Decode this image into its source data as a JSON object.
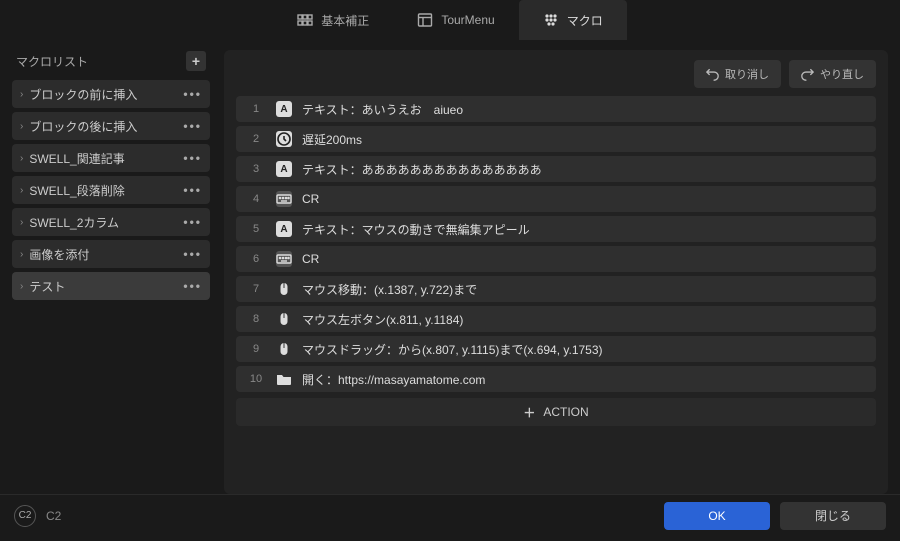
{
  "tabs": [
    {
      "label": "基本補正"
    },
    {
      "label": "TourMenu"
    },
    {
      "label": "マクロ"
    }
  ],
  "active_tab": 2,
  "sidebar": {
    "title": "マクロリスト",
    "items": [
      {
        "label": "ブロックの前に挿入"
      },
      {
        "label": "ブロックの後に挿入"
      },
      {
        "label": "SWELL_関連記事"
      },
      {
        "label": "SWELL_段落削除"
      },
      {
        "label": "SWELL_2カラム"
      },
      {
        "label": "画像を添付"
      },
      {
        "label": "テスト"
      }
    ],
    "active_index": 6
  },
  "toolbar": {
    "undo": "取り消し",
    "redo": "やり直し"
  },
  "actions": [
    {
      "n": 1,
      "icon": "A",
      "text": "テキスト：あいうえお　aiueo"
    },
    {
      "n": 2,
      "icon": "clock",
      "text": "遅延200ms"
    },
    {
      "n": 3,
      "icon": "A",
      "text": "テキスト：あああああああああああああああ"
    },
    {
      "n": 4,
      "icon": "kb",
      "text": "CR"
    },
    {
      "n": 5,
      "icon": "A",
      "text": "テキスト：マウスの動きで無編集アピール"
    },
    {
      "n": 6,
      "icon": "kb",
      "text": "CR"
    },
    {
      "n": 7,
      "icon": "mouse",
      "text": "マウス移動：(x.1387, y.722)まで"
    },
    {
      "n": 8,
      "icon": "mouse",
      "text": "マウス左ボタン(x.811, y.1184)"
    },
    {
      "n": 9,
      "icon": "mouse",
      "text": "マウスドラッグ：から(x.807, y.1115)まで(x.694, y.1753)"
    },
    {
      "n": 10,
      "icon": "folder",
      "text": "開く：https://masayamatome.com"
    }
  ],
  "add_action_label": "ACTION",
  "footer": {
    "badge": "C2",
    "text": "C2",
    "ok": "OK",
    "close": "閉じる"
  }
}
